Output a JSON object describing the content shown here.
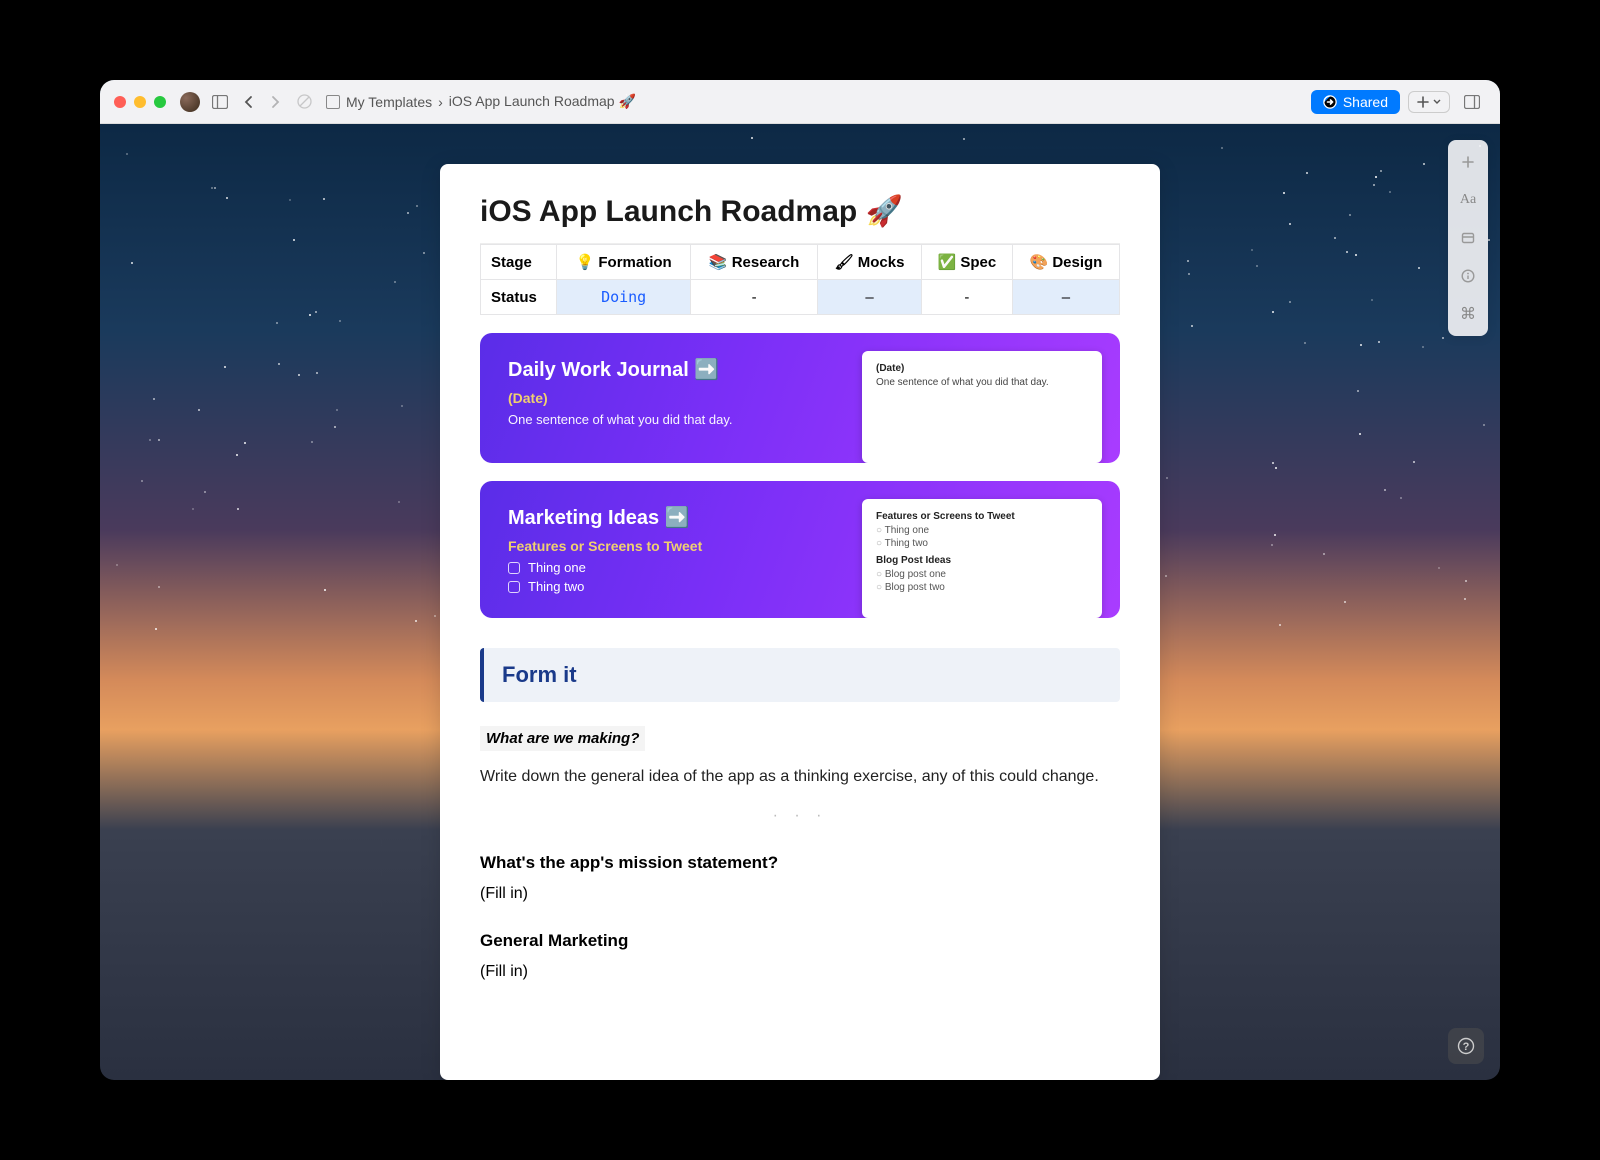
{
  "breadcrumb": {
    "parent": "My Templates",
    "sep": "›",
    "current": "iOS App Launch Roadmap 🚀"
  },
  "share_label": "Shared",
  "page": {
    "title": "iOS App Launch Roadmap 🚀",
    "table": {
      "headers": [
        "Stage",
        "💡 Formation",
        "📚 Research",
        "🖌 Mocks",
        "✅ Spec",
        "🎨 Design"
      ],
      "row_label": "Status",
      "row": [
        "Doing",
        "-",
        "–",
        "-",
        "–"
      ],
      "hl_cols": [
        1,
        3,
        5
      ]
    },
    "cards": [
      {
        "title": "Daily Work Journal ➡️",
        "sub": "(Date)",
        "desc": "One sentence of what you did that day.",
        "preview": {
          "h1": "(Date)",
          "t1": "One sentence of what you did that day."
        }
      },
      {
        "title": "Marketing Ideas ➡️",
        "sub": "Features or Screens to Tweet",
        "items": [
          "Thing one",
          "Thing two"
        ],
        "preview": {
          "h1": "Features or Screens to Tweet",
          "items1": [
            "Thing one",
            "Thing two"
          ],
          "h2": "Blog Post Ideas",
          "items2": [
            "Blog post one",
            "Blog post two"
          ]
        }
      }
    ],
    "callout": "Form it",
    "q1": "What are we making?",
    "body1": "Write down the general idea of the app as a thinking exercise, any of this could change.",
    "sec1": "What's the app's mission statement?",
    "fill1": "(Fill in)",
    "sec2": "General Marketing",
    "fill2": "(Fill in)"
  },
  "right_tools": [
    "plus-icon",
    "Aa",
    "card-icon",
    "info-icon",
    "cmd-icon"
  ]
}
